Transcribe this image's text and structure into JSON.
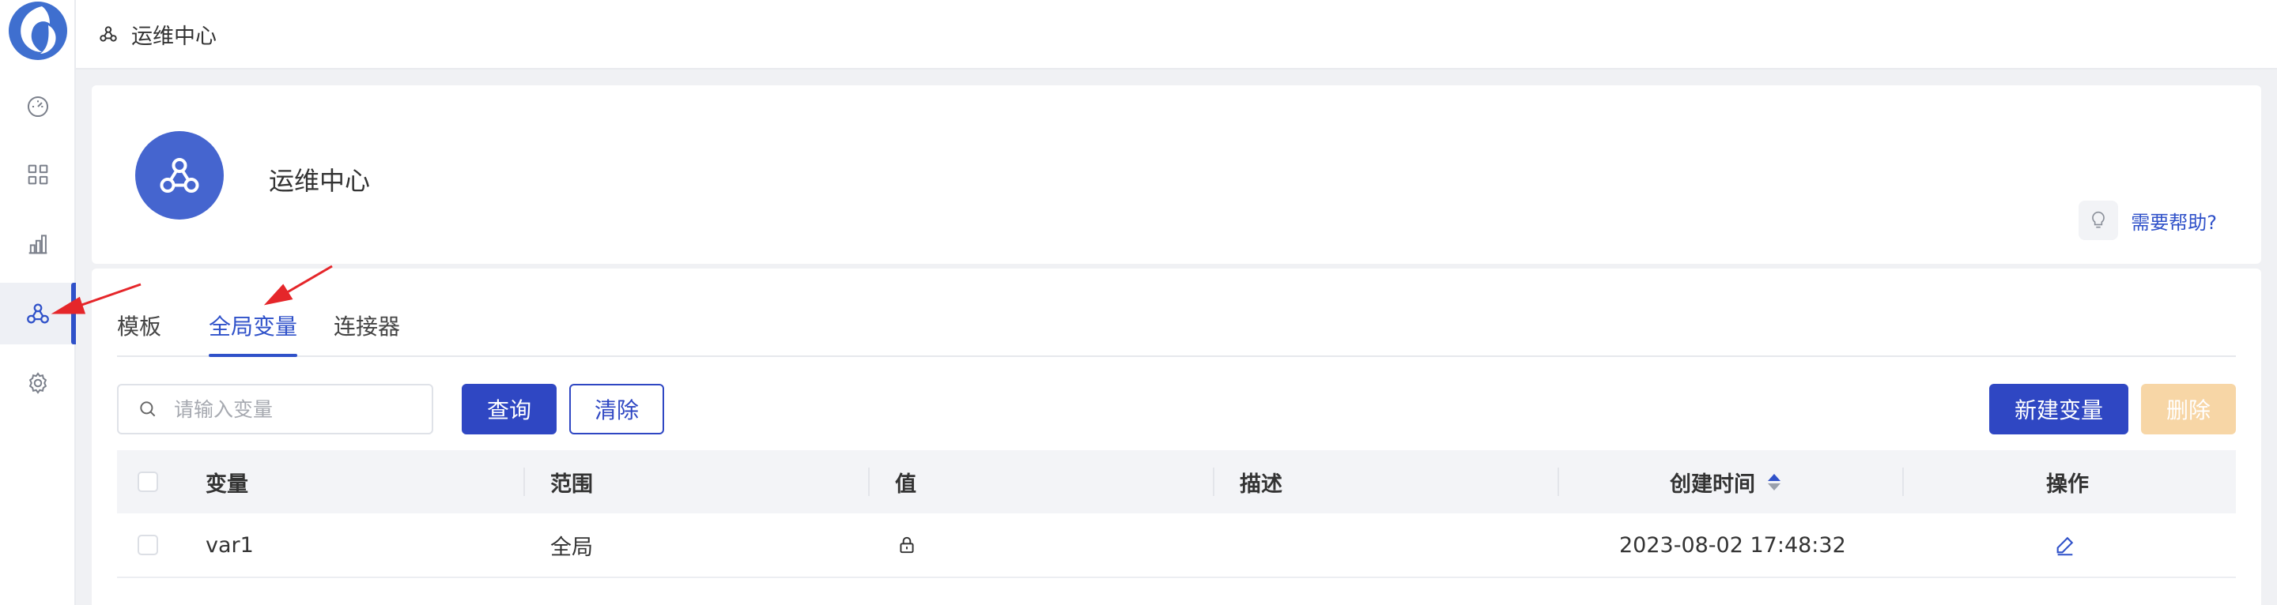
{
  "breadcrumb": {
    "title": "运维中心"
  },
  "sidebar": {
    "items": [
      {
        "name": "dashboard"
      },
      {
        "name": "apps"
      },
      {
        "name": "analytics"
      },
      {
        "name": "ops-center",
        "active": true
      },
      {
        "name": "settings"
      }
    ]
  },
  "header": {
    "title": "运维中心",
    "help_label": "需要帮助?"
  },
  "tabs": [
    {
      "label": "模板",
      "active": false
    },
    {
      "label": "全局变量",
      "active": true
    },
    {
      "label": "连接器",
      "active": false
    }
  ],
  "search": {
    "placeholder": "请输入变量",
    "value": ""
  },
  "buttons": {
    "query": "查询",
    "clear": "清除",
    "create": "新建变量",
    "delete": "删除"
  },
  "table": {
    "columns": [
      "变量",
      "范围",
      "值",
      "描述",
      "创建时间",
      "操作"
    ],
    "rows": [
      {
        "name": "var1",
        "scope": "全局",
        "value_icon": "lock-icon",
        "description": "",
        "created": "2023-08-02 17:48:32",
        "action_icon": "edit-icon"
      }
    ]
  },
  "colors": {
    "primary": "#2f47c3",
    "accent": "#2f51c9",
    "disabled": "#f7d6a6",
    "annotation": "#e5262a"
  }
}
